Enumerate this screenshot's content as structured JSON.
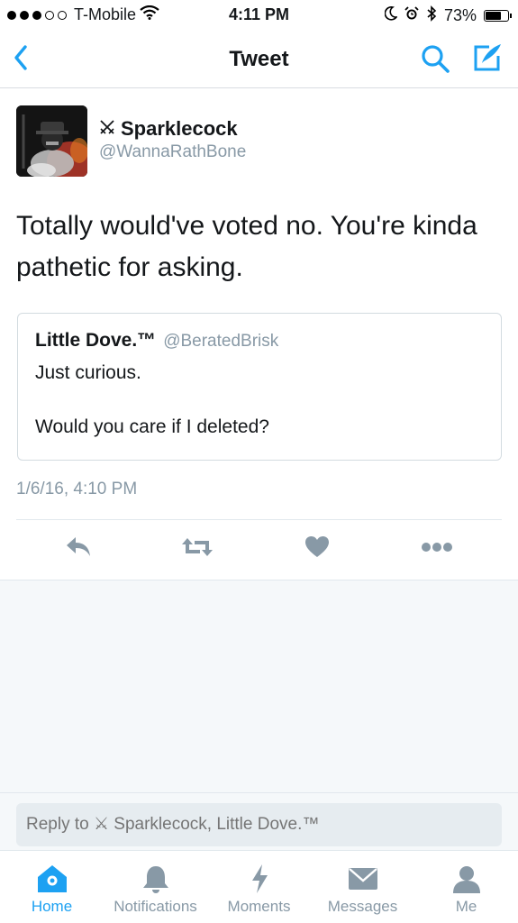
{
  "status_bar": {
    "carrier": "T-Mobile",
    "time": "4:11 PM",
    "battery": "73%",
    "battery_level": 0.73,
    "signal_bars_filled": 3,
    "signal_bars_total": 5
  },
  "nav": {
    "title": "Tweet",
    "back_icon": "chevron-left-icon",
    "search_icon": "search-icon",
    "compose_icon": "compose-icon"
  },
  "tweet": {
    "author_name": "Sparklecock",
    "author_prefix_icon": "crossed-swords-icon",
    "author_handle": "@WannaRathBone",
    "text": "Totally would've voted no. You're kinda pathetic for asking.",
    "quoted": {
      "name": "Little Dove.™",
      "handle": "@BeratedBrisk",
      "line1": "Just curious.",
      "line2": "Would you care if I deleted?"
    },
    "timestamp": "1/6/16, 4:10 PM"
  },
  "reply": {
    "placeholder": "Reply to ⚔ Sparklecock, Little Dove.™"
  },
  "tabs": [
    {
      "label": "Home",
      "icon": "home-icon",
      "active": true
    },
    {
      "label": "Notifications",
      "icon": "bell-icon",
      "active": false
    },
    {
      "label": "Moments",
      "icon": "lightning-icon",
      "active": false
    },
    {
      "label": "Messages",
      "icon": "envelope-icon",
      "active": false
    },
    {
      "label": "Me",
      "icon": "person-icon",
      "active": false
    }
  ],
  "colors": {
    "accent": "#1da1f2",
    "icon_gray": "#8899a6",
    "text": "#14171a"
  }
}
